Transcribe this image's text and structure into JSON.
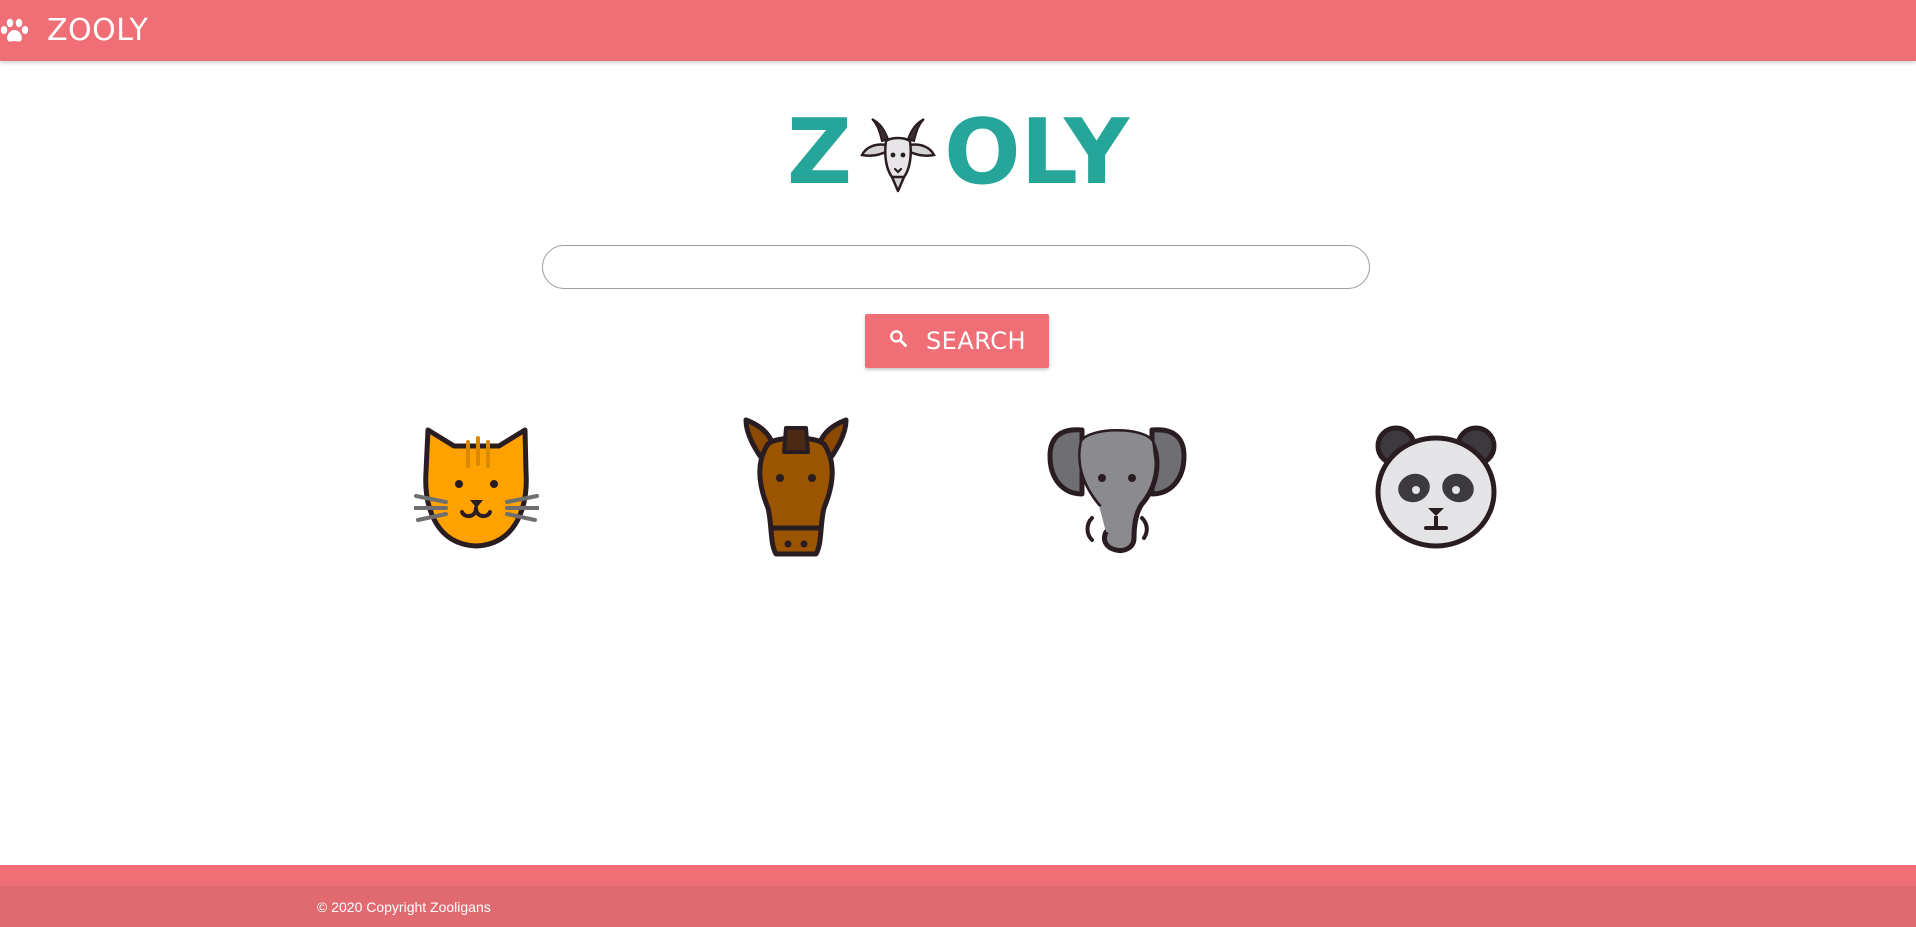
{
  "navbar": {
    "brand": "ZOOLY",
    "icon": "paw-icon",
    "color": "#f06e75"
  },
  "logo": {
    "left_letter": "Z",
    "right_letters": "OLY",
    "icon": "goat-icon",
    "color": "#26a69a"
  },
  "search": {
    "value": "",
    "placeholder": "",
    "button_label": "SEARCH",
    "button_icon": "search-icon"
  },
  "animals": [
    {
      "name": "cat",
      "icon": "cat-icon"
    },
    {
      "name": "horse",
      "icon": "horse-icon"
    },
    {
      "name": "elephant",
      "icon": "elephant-icon"
    },
    {
      "name": "panda",
      "icon": "panda-icon"
    }
  ],
  "footer": {
    "copyright": "© 2020 Copyright Zooligans",
    "color": "#e06a70"
  }
}
